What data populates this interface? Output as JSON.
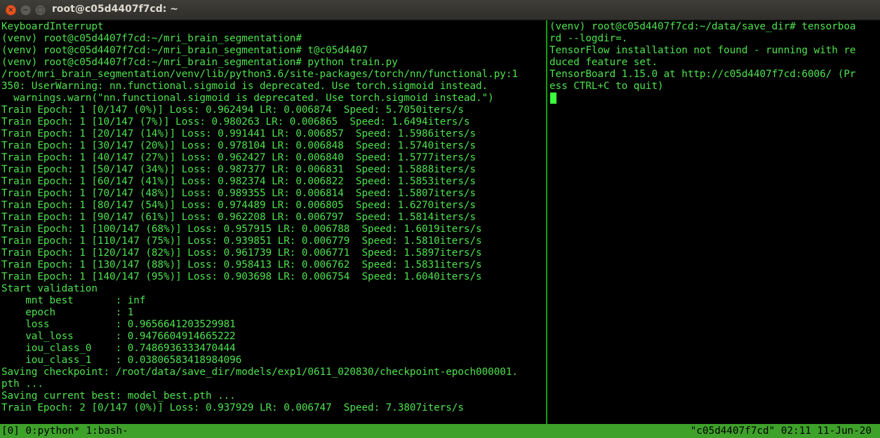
{
  "window": {
    "title": "root@c05d4407f7cd: ~",
    "close_glyph": "×",
    "minimize_glyph": "−",
    "maximize_glyph": "□"
  },
  "left_pane": {
    "lines": [
      "KeyboardInterrupt",
      "(venv) root@c05d4407f7cd:~/mri_brain_segmentation#",
      "(venv) root@c05d4407f7cd:~/mri_brain_segmentation# t@c05d4407",
      "(venv) root@c05d4407f7cd:~/mri_brain_segmentation# python train.py",
      "/root/mri_brain_segmentation/venv/lib/python3.6/site-packages/torch/nn/functional.py:1",
      "350: UserWarning: nn.functional.sigmoid is deprecated. Use torch.sigmoid instead.",
      "  warnings.warn(\"nn.functional.sigmoid is deprecated. Use torch.sigmoid instead.\")",
      "Train Epoch: 1 [0/147 (0%)] Loss: 0.962494 LR: 0.006874  Speed: 5.7050iters/s",
      "Train Epoch: 1 [10/147 (7%)] Loss: 0.980263 LR: 0.006865  Speed: 1.6494iters/s",
      "Train Epoch: 1 [20/147 (14%)] Loss: 0.991441 LR: 0.006857  Speed: 1.5986iters/s",
      "Train Epoch: 1 [30/147 (20%)] Loss: 0.978104 LR: 0.006848  Speed: 1.5740iters/s",
      "Train Epoch: 1 [40/147 (27%)] Loss: 0.962427 LR: 0.006840  Speed: 1.5777iters/s",
      "Train Epoch: 1 [50/147 (34%)] Loss: 0.987377 LR: 0.006831  Speed: 1.5888iters/s",
      "Train Epoch: 1 [60/147 (41%)] Loss: 0.982374 LR: 0.006822  Speed: 1.5853iters/s",
      "Train Epoch: 1 [70/147 (48%)] Loss: 0.989355 LR: 0.006814  Speed: 1.5807iters/s",
      "Train Epoch: 1 [80/147 (54%)] Loss: 0.974489 LR: 0.006805  Speed: 1.6270iters/s",
      "Train Epoch: 1 [90/147 (61%)] Loss: 0.962208 LR: 0.006797  Speed: 1.5814iters/s",
      "Train Epoch: 1 [100/147 (68%)] Loss: 0.957915 LR: 0.006788  Speed: 1.6019iters/s",
      "Train Epoch: 1 [110/147 (75%)] Loss: 0.939851 LR: 0.006779  Speed: 1.5810iters/s",
      "Train Epoch: 1 [120/147 (82%)] Loss: 0.961739 LR: 0.006771  Speed: 1.5897iters/s",
      "Train Epoch: 1 [130/147 (88%)] Loss: 0.958413 LR: 0.006762  Speed: 1.5831iters/s",
      "Train Epoch: 1 [140/147 (95%)] Loss: 0.903698 LR: 0.006754  Speed: 1.6040iters/s",
      "Start validation",
      "    mnt best       : inf",
      "    epoch          : 1",
      "    loss           : 0.9656641203529981",
      "    val_loss       : 0.9476604914665222",
      "    iou_class_0    : 0.7486936333470444",
      "    iou_class_1    : 0.03806583418984096",
      "Saving checkpoint: /root/data/save_dir/models/exp1/0611_020830/checkpoint-epoch000001.",
      "pth ...",
      "Saving current best: model_best.pth ...",
      "Train Epoch: 2 [0/147 (0%)] Loss: 0.937929 LR: 0.006747  Speed: 7.3807iters/s"
    ]
  },
  "right_pane": {
    "lines": [
      "(venv) root@c05d4407f7cd:~/data/save_dir# tensorboa",
      "rd --logdir=.",
      "TensorFlow installation not found - running with re",
      "duced feature set.",
      "TensorBoard 1.15.0 at http://c05d4407f7cd:6006/ (Pr",
      "ess CTRL+C to quit)"
    ]
  },
  "status_bar": {
    "windows": "[0] 0:python* 1:bash-",
    "right": "\"c05d4407f7cd\" 02:11 11-Jun-20"
  },
  "colors": {
    "terminal_text": "#4ee24e",
    "status_bar_bg": "#3ea12a",
    "pane_divider": "#13a10e",
    "close_button": "#e95420"
  }
}
